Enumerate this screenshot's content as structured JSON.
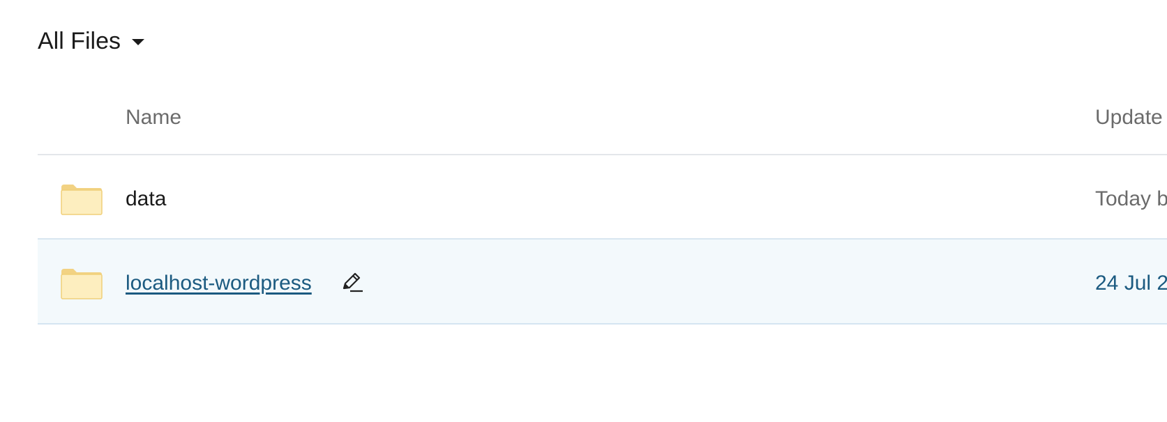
{
  "header": {
    "title": "All Files"
  },
  "table": {
    "columns": {
      "name": "Name",
      "updated": "Update"
    },
    "rows": [
      {
        "name": "data",
        "updated": "Today b",
        "type": "folder"
      },
      {
        "name": "localhost-wordpress",
        "updated": "24 Jul 2",
        "type": "folder"
      }
    ]
  },
  "icons": {
    "folder": "folder-icon",
    "edit": "pencil-edit-icon",
    "dropdown": "caret-down-icon"
  },
  "colors": {
    "link": "#1b5a80",
    "highlight_row": "#f3f9fc",
    "folder_fill": "#fdeebf",
    "folder_tab": "#f2d283"
  }
}
